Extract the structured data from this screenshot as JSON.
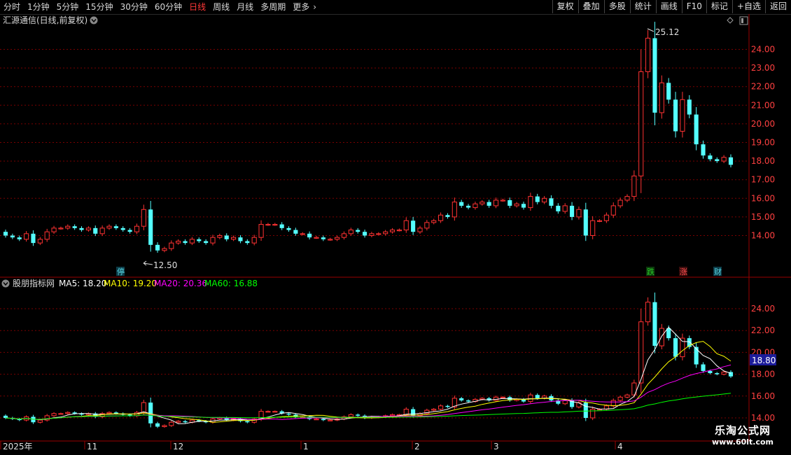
{
  "toolbar": {
    "periods": [
      "分时",
      "1分钟",
      "5分钟",
      "15分钟",
      "30分钟",
      "60分钟",
      "日线",
      "周线",
      "月线",
      "多周期",
      "更多"
    ],
    "active_index": 6,
    "more_arrow": "›",
    "buttons": [
      "复权",
      "叠加",
      "多股",
      "统计",
      "画线",
      "F10",
      "标记",
      "+自选",
      "返回"
    ]
  },
  "main_chart": {
    "title": "汇源通信(日线,前复权)",
    "price_ticks": [
      "24.00",
      "23.00",
      "22.00",
      "21.00",
      "20.00",
      "19.00",
      "18.00",
      "17.00",
      "16.00",
      "15.00",
      "14.00"
    ],
    "high_label": "25.12",
    "low_label": "12.50",
    "markers": [
      "停",
      "跌",
      "涨",
      "财"
    ],
    "marker_colors": [
      "#5ad8e6",
      "#28c828",
      "#ff5050",
      "#5ad8e6"
    ]
  },
  "indicator": {
    "name": "股朋指标网",
    "ma_labels": [
      "MA5: 18.20",
      "MA10: 19.20",
      "MA20: 20.36",
      "MA60: 16.88"
    ],
    "ma_colors": [
      "#ffffff",
      "#ffff00",
      "#ff00ff",
      "#00ff00"
    ],
    "price_ticks": [
      "24.00",
      "22.00",
      "20.00",
      "18.00",
      "16.00",
      "14.00"
    ],
    "current_price": "18.80"
  },
  "date_axis": [
    "2025年",
    "11",
    "12",
    "1",
    "2",
    "3",
    "4"
  ],
  "watermark": {
    "line1": "乐淘公式网",
    "line2": "www.60lt.com"
  },
  "colors": {
    "up": "#ff3232",
    "down": "#54ffff",
    "grid": "#7a0000",
    "axis": "#9a0000",
    "price_label": "#ff4040"
  },
  "chart_data": {
    "type": "candlestick",
    "title": "汇源通信(日线,前复权)",
    "ylim_main": [
      12.7,
      25.9
    ],
    "ylim_indicator": [
      13.5,
      25.2
    ],
    "high": 25.12,
    "low": 12.5,
    "close_series": [
      14.0,
      13.9,
      13.8,
      14.1,
      13.6,
      13.8,
      14.2,
      14.4,
      14.4,
      14.5,
      14.4,
      14.3,
      14.4,
      14.1,
      14.4,
      14.5,
      14.4,
      14.3,
      14.2,
      14.5,
      15.4,
      13.5,
      13.2,
      13.3,
      13.6,
      13.7,
      13.6,
      13.8,
      13.7,
      13.6,
      13.9,
      14.0,
      13.8,
      13.9,
      13.7,
      13.6,
      13.9,
      14.6,
      14.6,
      14.6,
      14.4,
      14.3,
      14.1,
      14.1,
      13.9,
      13.9,
      13.8,
      13.8,
      13.9,
      14.1,
      14.3,
      14.2,
      14.0,
      14.1,
      14.1,
      14.2,
      14.3,
      14.3,
      14.8,
      14.2,
      14.4,
      14.7,
      14.8,
      15.1,
      15.0,
      15.8,
      15.6,
      15.5,
      15.7,
      15.8,
      15.6,
      15.9,
      15.9,
      15.6,
      15.7,
      15.5,
      16.1,
      15.8,
      16.0,
      15.6,
      15.3,
      15.6,
      15.0,
      15.4,
      14.0,
      14.8,
      14.8,
      15.1,
      15.6,
      15.9,
      16.1,
      17.2,
      22.8,
      24.6,
      20.6,
      22.2,
      21.3,
      19.6,
      21.3,
      20.5,
      18.9,
      18.3,
      18.1,
      18.0,
      18.2,
      17.8
    ],
    "ma5_last": 18.2,
    "ma10_last": 19.2,
    "ma20_last": 20.36,
    "ma60_last": 16.88,
    "last_price": 18.8,
    "x_ticks": [
      "2025年",
      "11",
      "12",
      "1",
      "2",
      "3",
      "4"
    ]
  }
}
